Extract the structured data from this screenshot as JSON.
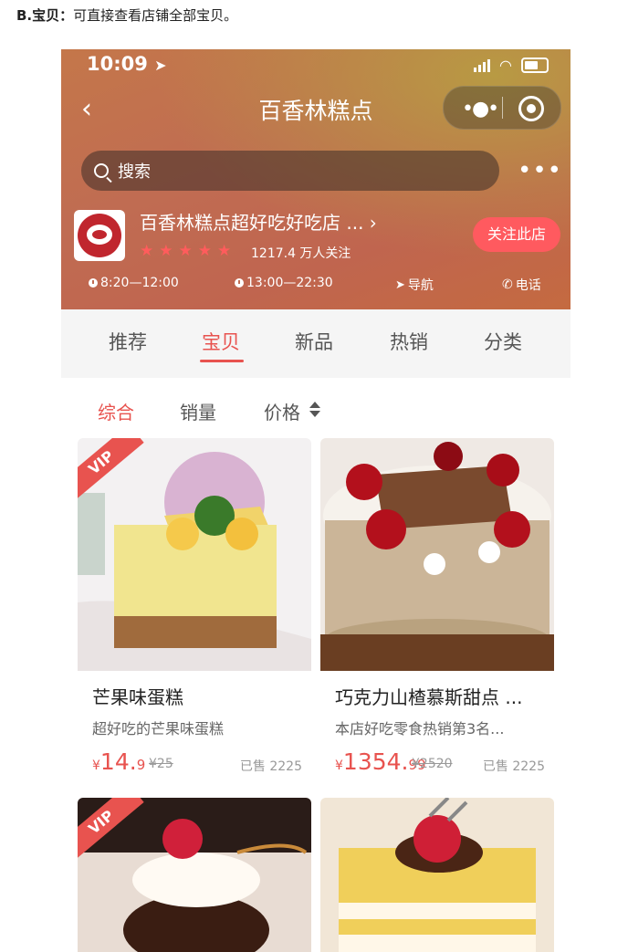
{
  "caption": {
    "label": "B.宝贝：",
    "text": "可直接查看店铺全部宝贝。"
  },
  "status_bar": {
    "time": "10:09"
  },
  "nav": {
    "back": "‹",
    "title": "百香林糕点"
  },
  "search": {
    "placeholder": "搜索"
  },
  "shop": {
    "name": "百香林糕点超好吃好吃店 ... ›",
    "followers": "1217.4 万人关注",
    "follow_button": "关注此店",
    "hours_1": "8:20—12:00",
    "hours_2": "13:00—22:30",
    "navigate": "导航",
    "call": "电话"
  },
  "tabs": [
    "推荐",
    "宝贝",
    "新品",
    "热销",
    "分类"
  ],
  "sorts": [
    "综合",
    "销量",
    "价格"
  ],
  "products": [
    {
      "name": "芒果味蛋糕",
      "desc": "超好吃的芒果味蛋糕",
      "cur": "¥",
      "price_int": "14.",
      "price_dec": "9",
      "old": "¥25",
      "sold": "已售 2225",
      "vip": "VIP"
    },
    {
      "name": "巧克力山楂慕斯甜点 ...",
      "desc": "本店好吃零食热销第3名...",
      "cur": "¥",
      "price_int": "1354.",
      "price_dec": "99",
      "old": "¥2520",
      "sold": "已售 2225",
      "vip": ""
    },
    {
      "vip": "VIP"
    },
    {
      "vip": ""
    }
  ],
  "colors": {
    "accent": "#e8534f",
    "header_start": "#c4774a",
    "header_end": "#c46a40"
  }
}
